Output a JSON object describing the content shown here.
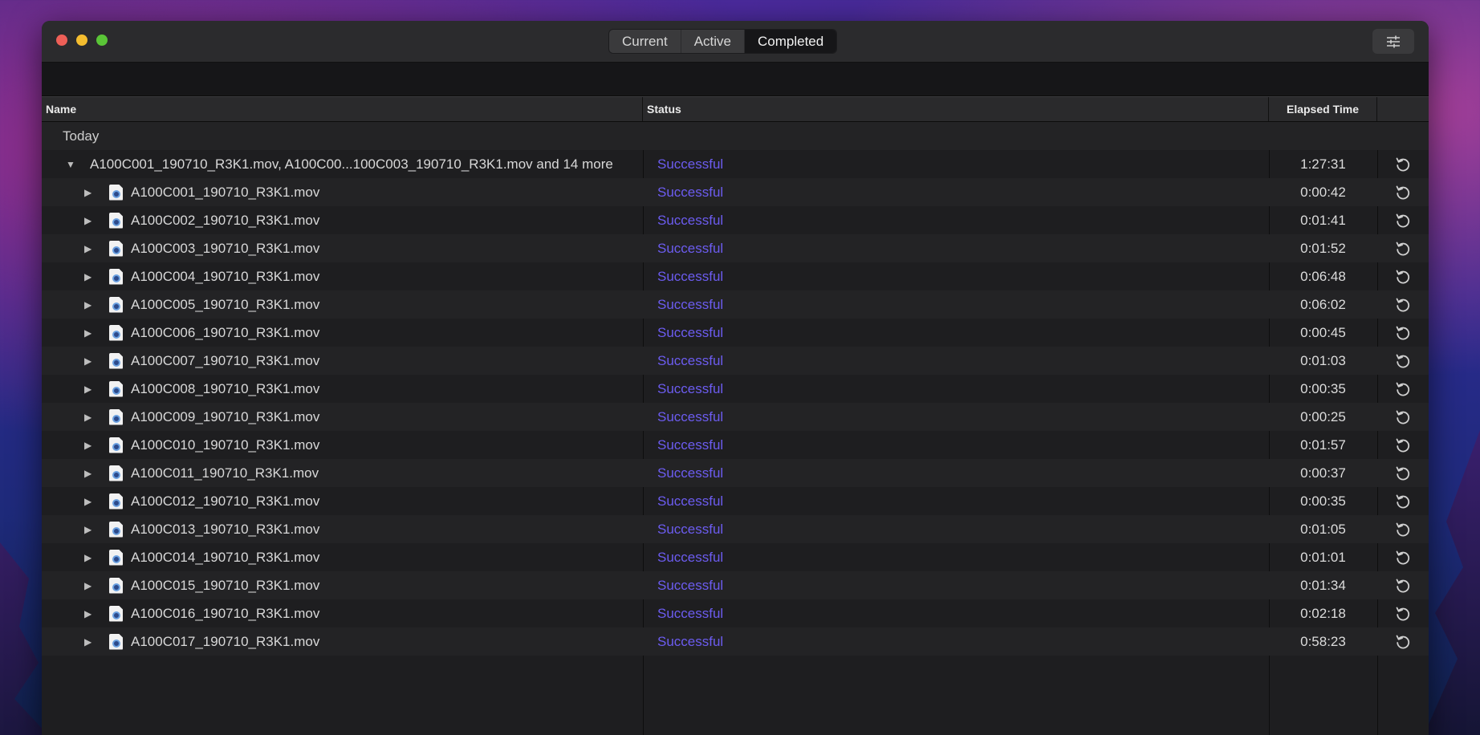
{
  "window": {
    "tabs": [
      {
        "label": "Current",
        "active": false
      },
      {
        "label": "Active",
        "active": false
      },
      {
        "label": "Completed",
        "active": true
      }
    ],
    "settings_icon": "sliders-icon"
  },
  "columns": {
    "name": "Name",
    "status": "Status",
    "elapsed": "Elapsed Time"
  },
  "group": {
    "label": "Today",
    "batch": {
      "name": "A100C001_190710_R3K1.mov, A100C00...100C003_190710_R3K1.mov and 14 more",
      "status": "Successful",
      "elapsed": "1:27:31"
    }
  },
  "files": [
    {
      "name": "A100C001_190710_R3K1.mov",
      "status": "Successful",
      "elapsed": "0:00:42"
    },
    {
      "name": "A100C002_190710_R3K1.mov",
      "status": "Successful",
      "elapsed": "0:01:41"
    },
    {
      "name": "A100C003_190710_R3K1.mov",
      "status": "Successful",
      "elapsed": "0:01:52"
    },
    {
      "name": "A100C004_190710_R3K1.mov",
      "status": "Successful",
      "elapsed": "0:06:48"
    },
    {
      "name": "A100C005_190710_R3K1.mov",
      "status": "Successful",
      "elapsed": "0:06:02"
    },
    {
      "name": "A100C006_190710_R3K1.mov",
      "status": "Successful",
      "elapsed": "0:00:45"
    },
    {
      "name": "A100C007_190710_R3K1.mov",
      "status": "Successful",
      "elapsed": "0:01:03"
    },
    {
      "name": "A100C008_190710_R3K1.mov",
      "status": "Successful",
      "elapsed": "0:00:35"
    },
    {
      "name": "A100C009_190710_R3K1.mov",
      "status": "Successful",
      "elapsed": "0:00:25"
    },
    {
      "name": "A100C010_190710_R3K1.mov",
      "status": "Successful",
      "elapsed": "0:01:57"
    },
    {
      "name": "A100C011_190710_R3K1.mov",
      "status": "Successful",
      "elapsed": "0:00:37"
    },
    {
      "name": "A100C012_190710_R3K1.mov",
      "status": "Successful",
      "elapsed": "0:00:35"
    },
    {
      "name": "A100C013_190710_R3K1.mov",
      "status": "Successful",
      "elapsed": "0:01:05"
    },
    {
      "name": "A100C014_190710_R3K1.mov",
      "status": "Successful",
      "elapsed": "0:01:01"
    },
    {
      "name": "A100C015_190710_R3K1.mov",
      "status": "Successful",
      "elapsed": "0:01:34"
    },
    {
      "name": "A100C016_190710_R3K1.mov",
      "status": "Successful",
      "elapsed": "0:02:18"
    },
    {
      "name": "A100C017_190710_R3K1.mov",
      "status": "Successful",
      "elapsed": "0:58:23"
    }
  ],
  "colors": {
    "status_success": "#6c5cf0",
    "accent_red": "#ee5f57",
    "accent_yellow": "#f4bd2f",
    "accent_green": "#5ac537"
  }
}
